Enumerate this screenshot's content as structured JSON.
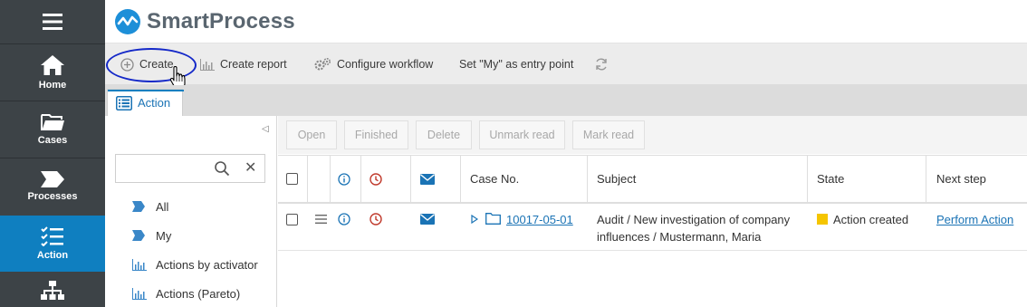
{
  "app": {
    "name": "SmartProcess"
  },
  "nav": {
    "items": [
      {
        "label": "Home",
        "icon": "home-icon"
      },
      {
        "label": "Cases",
        "icon": "folder-icon"
      },
      {
        "label": "Processes",
        "icon": "process-icon"
      },
      {
        "label": "Action",
        "icon": "checklist-icon",
        "active": true
      },
      {
        "label": "",
        "icon": "org-chart-icon"
      }
    ]
  },
  "toolbar": {
    "create": "Create",
    "create_report": "Create report",
    "configure_workflow": "Configure workflow",
    "set_entry_point": "Set \"My\" as entry point"
  },
  "tabs": [
    {
      "label": "Action"
    }
  ],
  "filters": {
    "search_value": "",
    "items": [
      {
        "label": "All",
        "icon": "tag-icon"
      },
      {
        "label": "My",
        "icon": "tag-icon"
      },
      {
        "label": "Actions by activator",
        "icon": "bar-chart-icon"
      },
      {
        "label": "Actions (Pareto)",
        "icon": "bar-chart-icon"
      }
    ]
  },
  "actions": {
    "open": "Open",
    "finished": "Finished",
    "delete": "Delete",
    "unmark_read": "Unmark read",
    "mark_read": "Mark read"
  },
  "grid": {
    "columns": {
      "case_no": "Case No.",
      "subject": "Subject",
      "state": "State",
      "next_step": "Next step"
    },
    "rows": [
      {
        "case_no": "10017-05-01",
        "subject_line1": "Audit / New investigation of company",
        "subject_line2": "influences / Mustermann, Maria",
        "state": "Action created",
        "state_color": "#f5c500",
        "next_step": "Perform Action"
      }
    ]
  },
  "colors": {
    "nav_bg": "#3d4347",
    "nav_active": "#0f7fc0",
    "accent": "#1a73b5",
    "highlight_ring": "#1428c8",
    "clock_red": "#c0392b"
  }
}
